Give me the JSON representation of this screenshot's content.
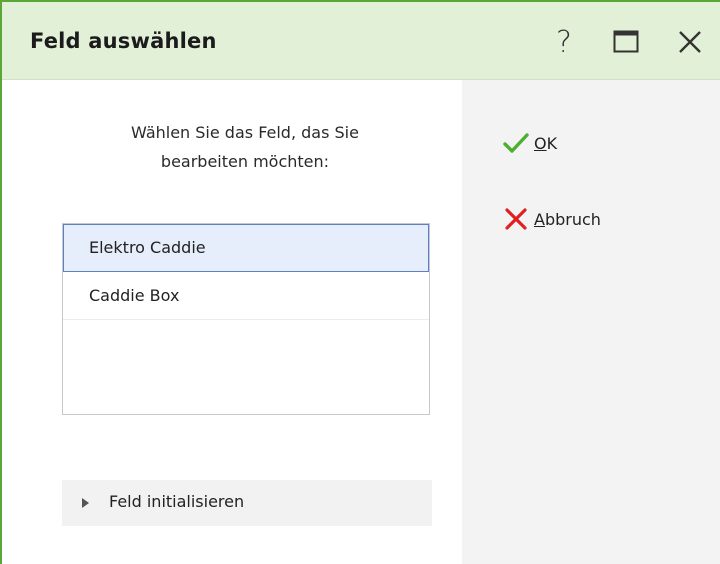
{
  "dialog": {
    "title": "Feld auswählen",
    "title_buttons": {
      "help": "?",
      "maximize": "maximize-icon",
      "close": "close-icon"
    }
  },
  "prompt": {
    "line1": "Wählen Sie das Feld, das Sie",
    "line2": "bearbeiten möchten:"
  },
  "field_list": {
    "items": [
      {
        "label": "Elektro Caddie",
        "selected": true
      },
      {
        "label": "Caddie Box",
        "selected": false
      }
    ]
  },
  "expander": {
    "label": "Feld initialisieren",
    "icon": "triangle-right-icon"
  },
  "actions": {
    "ok": {
      "mnemonic": "O",
      "rest": "K",
      "icon": "checkmark-icon",
      "color": "#4caf2f"
    },
    "cancel": {
      "mnemonic": "A",
      "rest": "bbruch",
      "icon": "cross-icon",
      "color": "#e02020"
    }
  },
  "colors": {
    "title_bg": "#e2f0d7",
    "window_border": "#5aa638",
    "selection_bg": "#e6eefc",
    "selection_border": "#5a80c8",
    "side_panel_bg": "#f3f3f3"
  }
}
